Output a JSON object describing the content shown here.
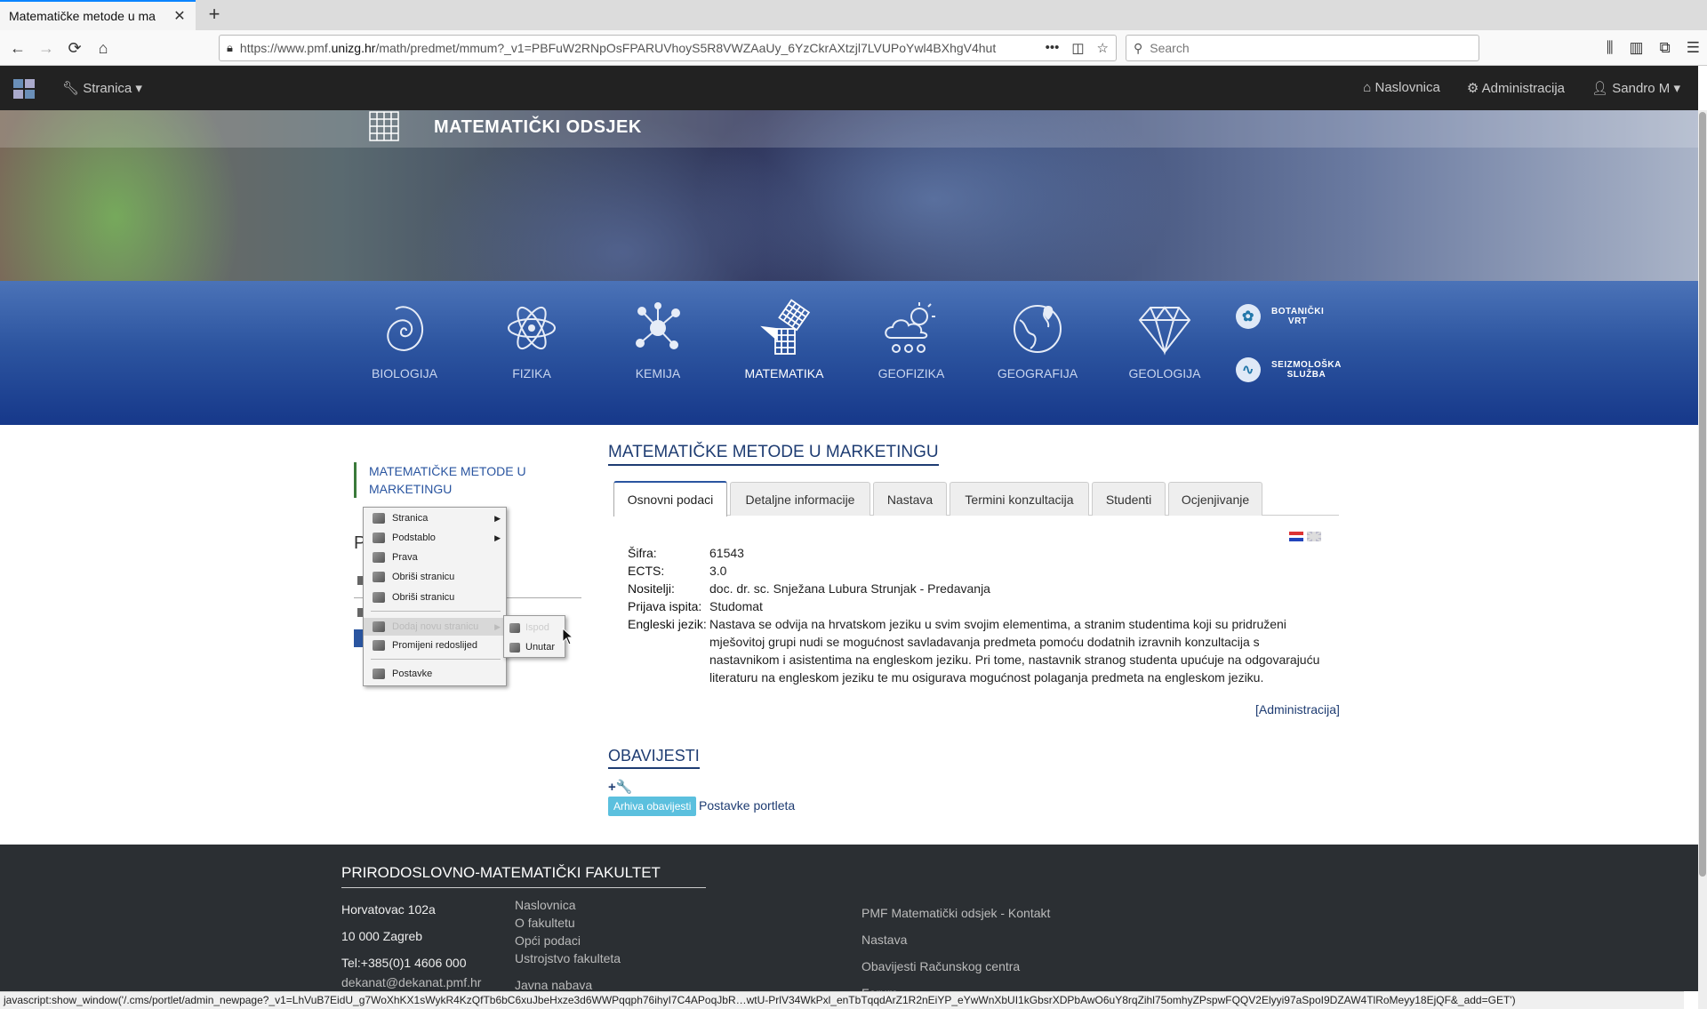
{
  "browser": {
    "tab_title": "Matematičke metode u ma",
    "url_prefix": "https://www.pmf.",
    "url_domain": "unizg.hr",
    "url_rest": "/math/predmet/mmum?_v1=PBFuW2RNpOsFPARUVhoyS5R8VWZAaUy_6YzCkrAXtzjl7LVUPoYwl4BXhgV4hut",
    "search_placeholder": "Search",
    "status_text": "javascript:show_window('/.cms/portlet/admin_newpage?_v1=LhVuB7EidU_g7WoXhKX1sWykR4KzQfTb6bC6xuJbeHxze3d6WWPqqph76ihyI7C4APoqJbR…wtU-PrlV34WkPxl_enTbTqqdArZ1R2nEiYP_eYwWnXbUI1kGbsrXDPbAwO6uY8rqZihl75omhyZPspwFQQV2Elyyi97aSpoI9DZAW4TlRoMeyy18EjQF&_add=GET')"
  },
  "adminbar": {
    "menu": "Stranica",
    "home": "Naslovnica",
    "admin": "Administracija",
    "user": "Sandro M"
  },
  "hero": {
    "department": "MATEMATIČKI ODSJEK"
  },
  "faculties": [
    {
      "label": "BIOLOGIJA",
      "icon": "shell-icon"
    },
    {
      "label": "FIZIKA",
      "icon": "atom-icon"
    },
    {
      "label": "KEMIJA",
      "icon": "molecule-icon"
    },
    {
      "label": "MATEMATIKA",
      "icon": "grid-icon"
    },
    {
      "label": "GEOFIZIKA",
      "icon": "cloud-icon"
    },
    {
      "label": "GEOGRAFIJA",
      "icon": "globe-icon"
    },
    {
      "label": "GEOLOGIJA",
      "icon": "diamond-icon"
    }
  ],
  "side_links": [
    {
      "line1": "BOTANIČKI",
      "line2": "VRT"
    },
    {
      "line1": "SEIZMOLOŠKA",
      "line2": "SLUŽBA"
    }
  ],
  "sidebar": {
    "title": "MATEMATIČKE METODE U MARKETINGU",
    "p_letter": "P"
  },
  "context_menu": {
    "items": [
      "Stranica",
      "Podstablo",
      "Prava",
      "Obriši stranicu",
      "Obriši stranicu",
      "Dodaj novu stranicu",
      "Promijeni redoslijed",
      "Postavke"
    ],
    "submenu": [
      "Ispod",
      "Unutar"
    ]
  },
  "main": {
    "title": "MATEMATIČKE METODE U MARKETINGU",
    "tabs": [
      "Osnovni podaci",
      "Detaljne informacije",
      "Nastava",
      "Termini konzultacija",
      "Studenti",
      "Ocjenjivanje"
    ],
    "info": {
      "sifra_label": "Šifra:",
      "sifra": "61543",
      "ects_label": "ECTS:",
      "ects": "3.0",
      "nositelji_label": "Nositelji:",
      "nositelji": "doc. dr. sc. Snježana Lubura Strunjak - Predavanja",
      "prijava_label": "Prijava ispita:",
      "prijava": "Studomat",
      "engleski_label": "Engleski jezik:",
      "engleski": "Nastava se odvija na hrvatskom jeziku u svim svojim elementima, a stranim studentima koji su pridruženi mješovitoj grupi nudi se mogućnost savladavanja predmeta pomoću dodatnih izravnih konzultacija s nastavnikom i asistentima na engleskom jeziku. Pri tome, nastavnik stranog studenta upućuje na odgovarajuću literaturu na engleskom jeziku te mu osigurava mogućnost polaganja predmeta na engleskom jeziku."
    },
    "admin_link": "[Administracija]",
    "obav_title": "OBAVIJESTI",
    "obav_icons": "+🔧",
    "arhiva": "Arhiva obavijesti",
    "postavke": "Postavke portleta"
  },
  "footer": {
    "title": "PRIRODOSLOVNO-MATEMATIČKI FAKULTET",
    "address": [
      "Horvatovac 102a",
      "10 000 Zagreb",
      "Tel:+385(0)1 4606 000",
      "dekanat@dekanat.pmf.hr"
    ],
    "links": [
      "Naslovnica",
      "O fakultetu",
      "Opći podaci",
      "Ustrojstvo fakulteta",
      "",
      "Javna nabava"
    ],
    "links2": [
      "PMF Matematički odsjek - Kontakt",
      "Nastava",
      "Obavijesti Računskog centra",
      "Forum"
    ]
  }
}
